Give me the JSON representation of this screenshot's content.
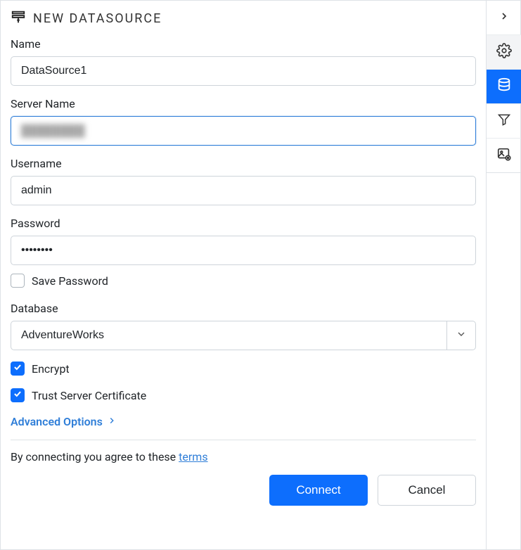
{
  "header": {
    "title": "NEW DATASOURCE"
  },
  "form": {
    "name": {
      "label": "Name",
      "value": "DataSource1"
    },
    "serverName": {
      "label": "Server Name",
      "value": "████████"
    },
    "username": {
      "label": "Username",
      "value": "admin"
    },
    "password": {
      "label": "Password",
      "value": "••••••••"
    },
    "savePassword": {
      "label": "Save Password",
      "checked": false
    },
    "database": {
      "label": "Database",
      "value": "AdventureWorks"
    },
    "encrypt": {
      "label": "Encrypt",
      "checked": true
    },
    "trustCert": {
      "label": "Trust Server Certificate",
      "checked": true
    }
  },
  "links": {
    "advancedOptions": "Advanced Options",
    "termsPrefix": "By connecting you agree to these ",
    "termsLink": "terms"
  },
  "buttons": {
    "connect": "Connect",
    "cancel": "Cancel"
  },
  "sidebar": {
    "items": [
      {
        "name": "expand",
        "active": false
      },
      {
        "name": "settings",
        "active": false,
        "light": true
      },
      {
        "name": "datasource",
        "active": true
      },
      {
        "name": "filter",
        "active": false
      },
      {
        "name": "image-settings",
        "active": false
      }
    ]
  }
}
